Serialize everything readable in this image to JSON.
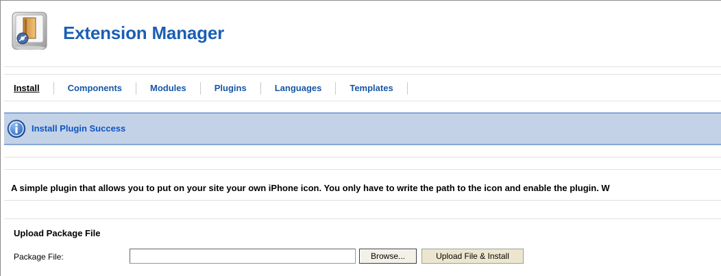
{
  "header": {
    "title": "Extension Manager",
    "icon": "extension-manager-icon"
  },
  "tabs": [
    {
      "label": "Install",
      "active": true
    },
    {
      "label": "Components",
      "active": false
    },
    {
      "label": "Modules",
      "active": false
    },
    {
      "label": "Plugins",
      "active": false
    },
    {
      "label": "Languages",
      "active": false
    },
    {
      "label": "Templates",
      "active": false
    }
  ],
  "message": {
    "icon": "info-icon",
    "text": "Install Plugin Success"
  },
  "description": "A simple plugin that allows you to put on your site your own iPhone icon. You only have to write the path to the icon and enable the plugin. W",
  "upload": {
    "section_title": "Upload Package File",
    "file_label": "Package File:",
    "file_value": "",
    "browse_label": "Browse...",
    "submit_label": "Upload File & Install"
  },
  "colors": {
    "title": "#1a5fb4",
    "tab_link": "#1656a6",
    "message_bg": "#c3d2e6",
    "message_border": "#84a7d7",
    "message_text": "#0b55c4"
  }
}
